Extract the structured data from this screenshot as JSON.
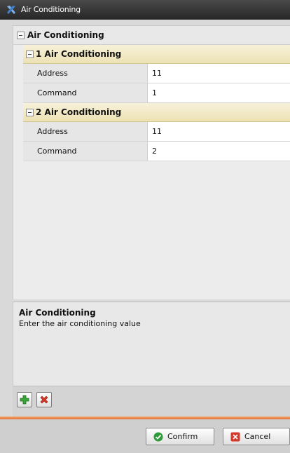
{
  "window": {
    "title": "Air Conditioning"
  },
  "grid": {
    "root_label": "Air Conditioning",
    "groups": [
      {
        "label": "1 Air Conditioning",
        "properties": [
          {
            "name": "Address",
            "value": "11"
          },
          {
            "name": "Command",
            "value": "1"
          }
        ]
      },
      {
        "label": "2 Air Conditioning",
        "properties": [
          {
            "name": "Address",
            "value": "11"
          },
          {
            "name": "Command",
            "value": "2"
          }
        ]
      }
    ]
  },
  "description": {
    "title": "Air Conditioning",
    "text": "Enter the air conditioning value"
  },
  "footer": {
    "confirm_label": "Confirm",
    "cancel_label": "Cancel"
  },
  "icons": {
    "window_icon": "tools-x-icon",
    "add": "add-icon",
    "remove": "remove-icon",
    "confirm": "check-circle-icon",
    "cancel": "cancel-icon"
  },
  "colors": {
    "title_bar": "#2f2f2f",
    "group_header": "#f2eac6",
    "accent_line": "#e8834a"
  }
}
